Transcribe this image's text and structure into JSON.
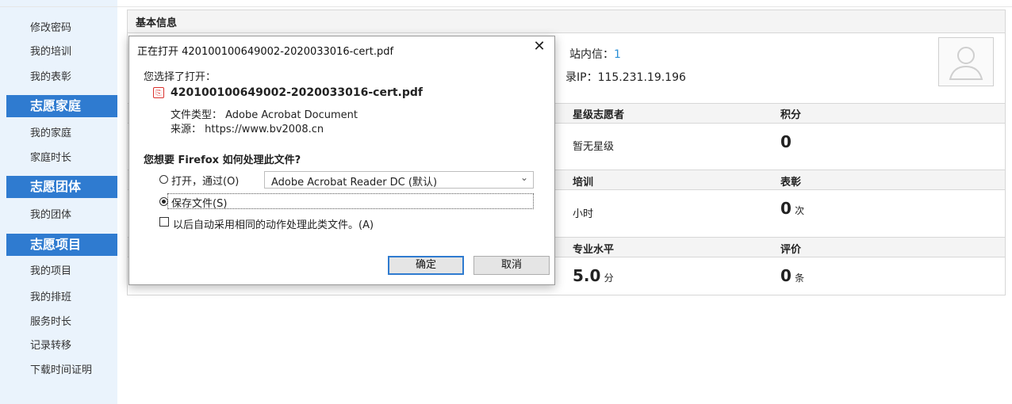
{
  "sidebar": {
    "links_top": [
      "修改密码",
      "我的培训",
      "我的表彰"
    ],
    "section_family": "志愿家庭",
    "links_family": [
      "我的家庭",
      "家庭时长"
    ],
    "section_group": "志愿团体",
    "links_group": [
      "我的团体"
    ],
    "section_project": "志愿项目",
    "links_project": [
      "我的项目",
      "我的排班",
      "服务时长",
      "记录转移",
      "下载时间证明"
    ]
  },
  "main": {
    "title": "基本信息",
    "mail_label": "站内信：",
    "mail_count": "1",
    "ip_label": "录IP：115.231.19.196",
    "rows": [
      {
        "h1": "星级志愿者",
        "h2": "积分",
        "v1": "暂无星级",
        "v2": "0",
        "v2_unit": ""
      },
      {
        "h1": "培训",
        "h2": "表彰",
        "v1": "小时",
        "v2": "0",
        "v2_unit": "次"
      },
      {
        "h1": "专业水平",
        "h2": "评价",
        "v1": "5.0",
        "v1_unit": "分",
        "v2": "0",
        "v2_unit": "条"
      }
    ]
  },
  "dialog": {
    "title": "正在打开 420100100649002-2020033016-cert.pdf",
    "you_chose": "您选择了打开：",
    "file_name": "420100100649002-2020033016-cert.pdf",
    "file_type": "文件类型：  Adobe Acrobat Document",
    "source": "来源：  https://www.bv2008.cn",
    "question": "您想要 Firefox 如何处理此文件?",
    "open_with_label": "打开，通过(O)",
    "open_with_app": "Adobe Acrobat Reader DC (默认)",
    "save_label": "保存文件(S)",
    "auto_label": "以后自动采用相同的动作处理此类文件。(A)",
    "ok": "确定",
    "cancel": "取消"
  }
}
